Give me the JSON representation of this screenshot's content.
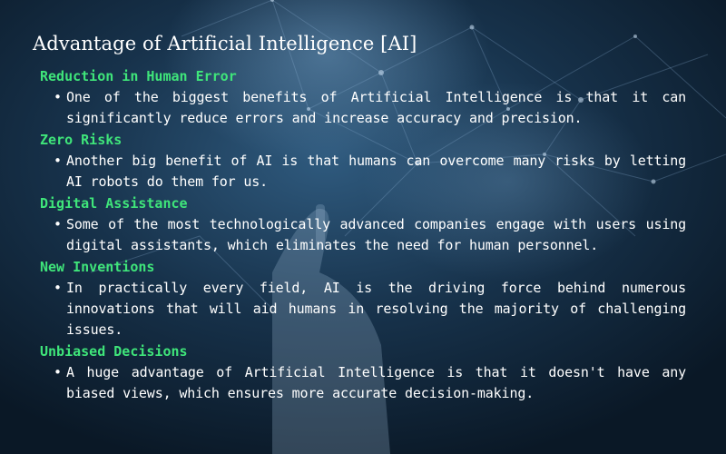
{
  "title": "Advantage of Artificial Intelligence [AI]",
  "sections": [
    {
      "heading": "Reduction in Human Error",
      "bullet": "One of the biggest benefits of Artificial Intelligence is that it can significantly reduce errors and increase accuracy and precision."
    },
    {
      "heading": "Zero Risks",
      "bullet": "Another big benefit of AI is that humans can overcome many risks by letting AI robots do them for us."
    },
    {
      "heading": "Digital Assistance",
      "bullet": "Some of the most technologically advanced companies engage with users using digital assistants, which eliminates the need for human personnel."
    },
    {
      "heading": "New Inventions",
      "bullet": "In practically every field, AI is the driving force behind numerous innovations that will aid humans in resolving the majority of challenging issues."
    },
    {
      "heading": "Unbiased Decisions",
      "bullet": "A huge advantage of Artificial Intelligence is that it doesn't have any biased views, which ensures more accurate decision-making."
    }
  ],
  "colors": {
    "background": "#0f2436",
    "heading": "#3fe57a",
    "text": "#ffffff"
  },
  "background_image": "robot-hand-neural-network-image"
}
